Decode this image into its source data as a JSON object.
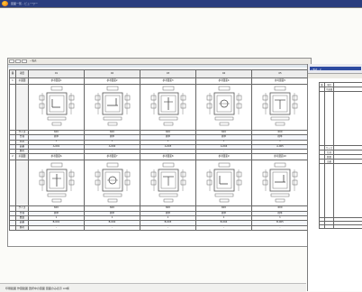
{
  "window": {
    "title": "図面一覧 - ビューワー"
  },
  "main_sheet": {
    "title": "一覧表",
    "header": [
      "番",
      "項目",
      "01",
      "02",
      "03",
      "04",
      "05"
    ],
    "groups": [
      {
        "number": "1",
        "label": "平面図",
        "name_row": [
          "参考図面1",
          "参考図面2",
          "参考図面3",
          "参考図面4",
          "参考図面5"
        ],
        "rows": [
          {
            "label": "サイズ",
            "values": [
              "600",
              "600",
              "600",
              "600",
              "600"
            ]
          },
          {
            "label": "仕様",
            "values": [
              "標準",
              "標準",
              "標準",
              "標準",
              "標準"
            ]
          },
          {
            "label": "数量",
            "values": [
              "1",
              "1",
              "1",
              "1",
              "1"
            ]
          },
          {
            "label": "品番",
            "values": [
              "A-001",
              "A-002",
              "A-003",
              "A-004",
              "A-005"
            ]
          },
          {
            "label": "備考",
            "values": [
              "-",
              "-",
              "-",
              "-",
              "-"
            ]
          }
        ]
      },
      {
        "number": "2",
        "label": "平面図",
        "name_row": [
          "参考図面6",
          "参考図面7",
          "参考図面8",
          "参考図面9",
          "参考図面10"
        ],
        "rows": [
          {
            "label": "サイズ",
            "values": [
              "600",
              "600",
              "600",
              "600",
              "600"
            ]
          },
          {
            "label": "仕様",
            "values": [
              "標準",
              "標準",
              "標準",
              "標準",
              "標準"
            ]
          },
          {
            "label": "数量",
            "values": [
              "1",
              "1",
              "1",
              "1",
              "1"
            ]
          },
          {
            "label": "品番",
            "values": [
              "B-001",
              "B-002",
              "B-003",
              "B-004",
              "B-005"
            ]
          },
          {
            "label": "備考",
            "values": [
              "-",
              "-",
              "-",
              "-",
              "-"
            ]
          }
        ]
      }
    ]
  },
  "second_window": {
    "title": "一覧表 - 2",
    "header": [
      "番",
      "項目"
    ],
    "labels": [
      "平面図",
      "サイズ",
      "仕様",
      "数量",
      "品番"
    ]
  },
  "status_bar": {
    "text": "印刷範囲 作図範囲 選択中の図面 図面のみ表示 A4横"
  }
}
